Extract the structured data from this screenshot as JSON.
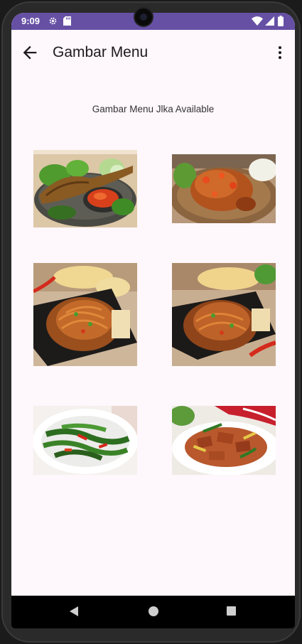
{
  "status_bar": {
    "time": "9:09"
  },
  "app_bar": {
    "title": "Gambar Menu"
  },
  "content": {
    "subtitle": "Gambar Menu Jlka Available",
    "images": [
      {
        "name": "menu-image-1"
      },
      {
        "name": "menu-image-2"
      },
      {
        "name": "menu-image-3"
      },
      {
        "name": "menu-image-4"
      },
      {
        "name": "menu-image-5"
      },
      {
        "name": "menu-image-6"
      }
    ]
  },
  "colors": {
    "status_bar": "#6650a4",
    "background": "#fef7fb",
    "nav_bar": "#000000"
  }
}
